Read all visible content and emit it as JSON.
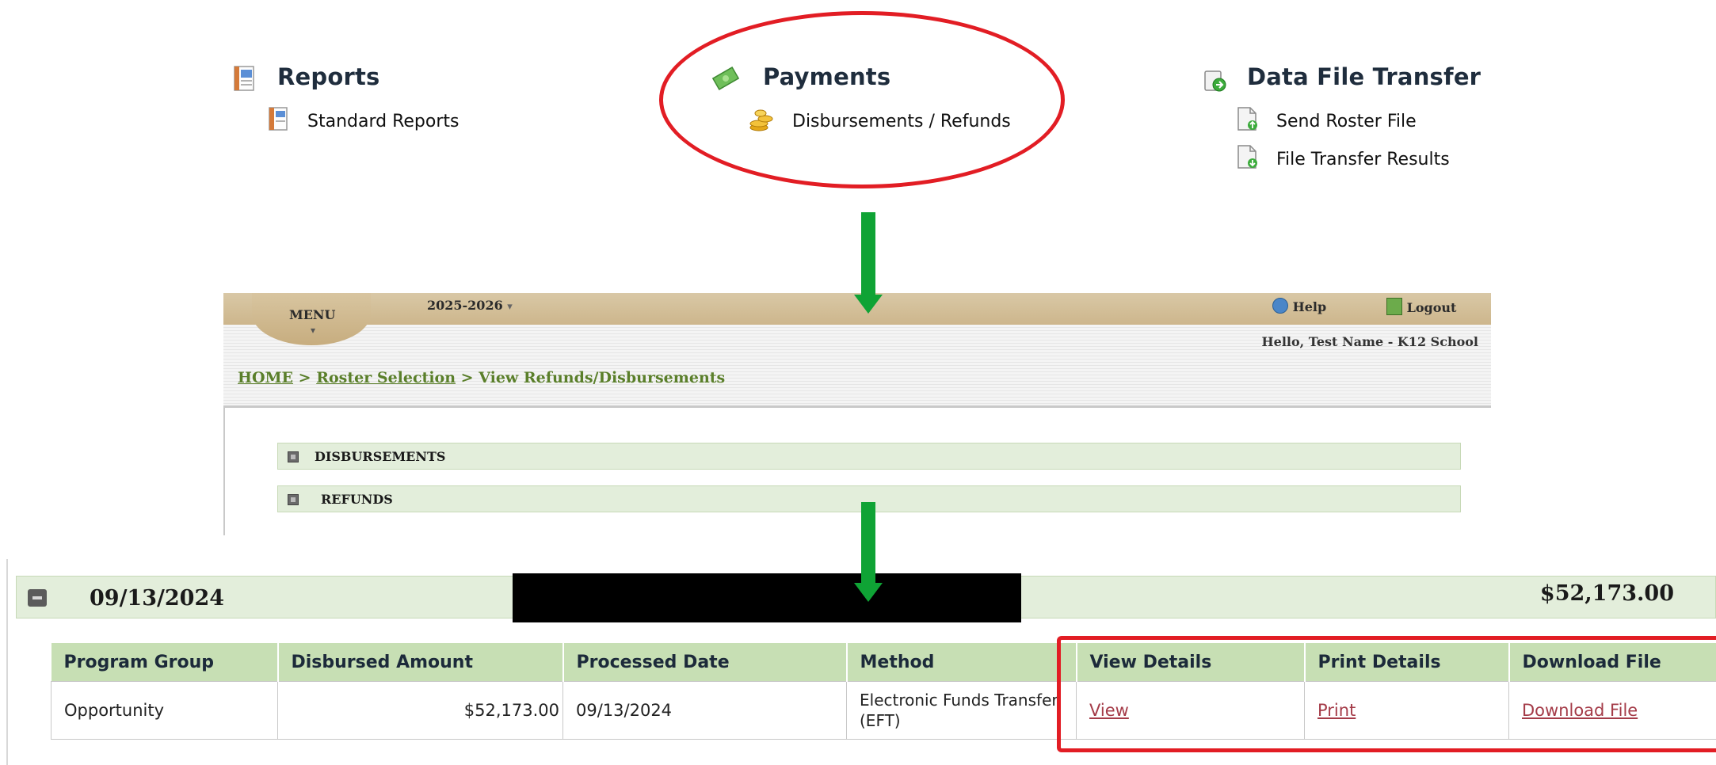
{
  "menu_groups": {
    "reports": {
      "title": "Reports",
      "icon": "report-icon",
      "links": [
        "Standard Reports"
      ]
    },
    "payments": {
      "title": "Payments",
      "icon": "money-icon",
      "links": [
        "Disbursements / Refunds"
      ]
    },
    "data_transfer": {
      "title": "Data File Transfer",
      "icon": "transfer-icon",
      "links": [
        "Send Roster File",
        "File Transfer Results"
      ]
    }
  },
  "app_header": {
    "menu_label": "MENU",
    "year": "2025-2026",
    "help_label": "Help",
    "logout_label": "Logout",
    "greeting": "Hello, Test Name - K12 School"
  },
  "breadcrumb": {
    "home": "HOME",
    "sep": ">",
    "roster": "Roster Selection",
    "current": "View Refunds/Disbursements"
  },
  "sections": [
    "DISBURSEMENTS",
    "REFUNDS"
  ],
  "disbursement": {
    "date": "09/13/2024",
    "total": "$52,173.00",
    "columns": [
      "Program Group",
      "Disbursed Amount",
      "Processed Date",
      "Method",
      "View Details",
      "Print Details",
      "Download File"
    ],
    "row": {
      "program_group": "Opportunity",
      "amount": "$52,173.00",
      "processed_date": "09/13/2024",
      "method": "Electronic Funds Transfer (EFT)",
      "view": "View",
      "print": "Print",
      "download": "Download File"
    }
  },
  "colors": {
    "highlight_red": "#e21d24",
    "arrow_green": "#0fa335",
    "header_tan": "#cdb68c",
    "section_green": "#e3eedb",
    "table_header_green": "#c7dfb4",
    "link_red": "#a43b48",
    "breadcrumb_green": "#5a7f2a"
  }
}
